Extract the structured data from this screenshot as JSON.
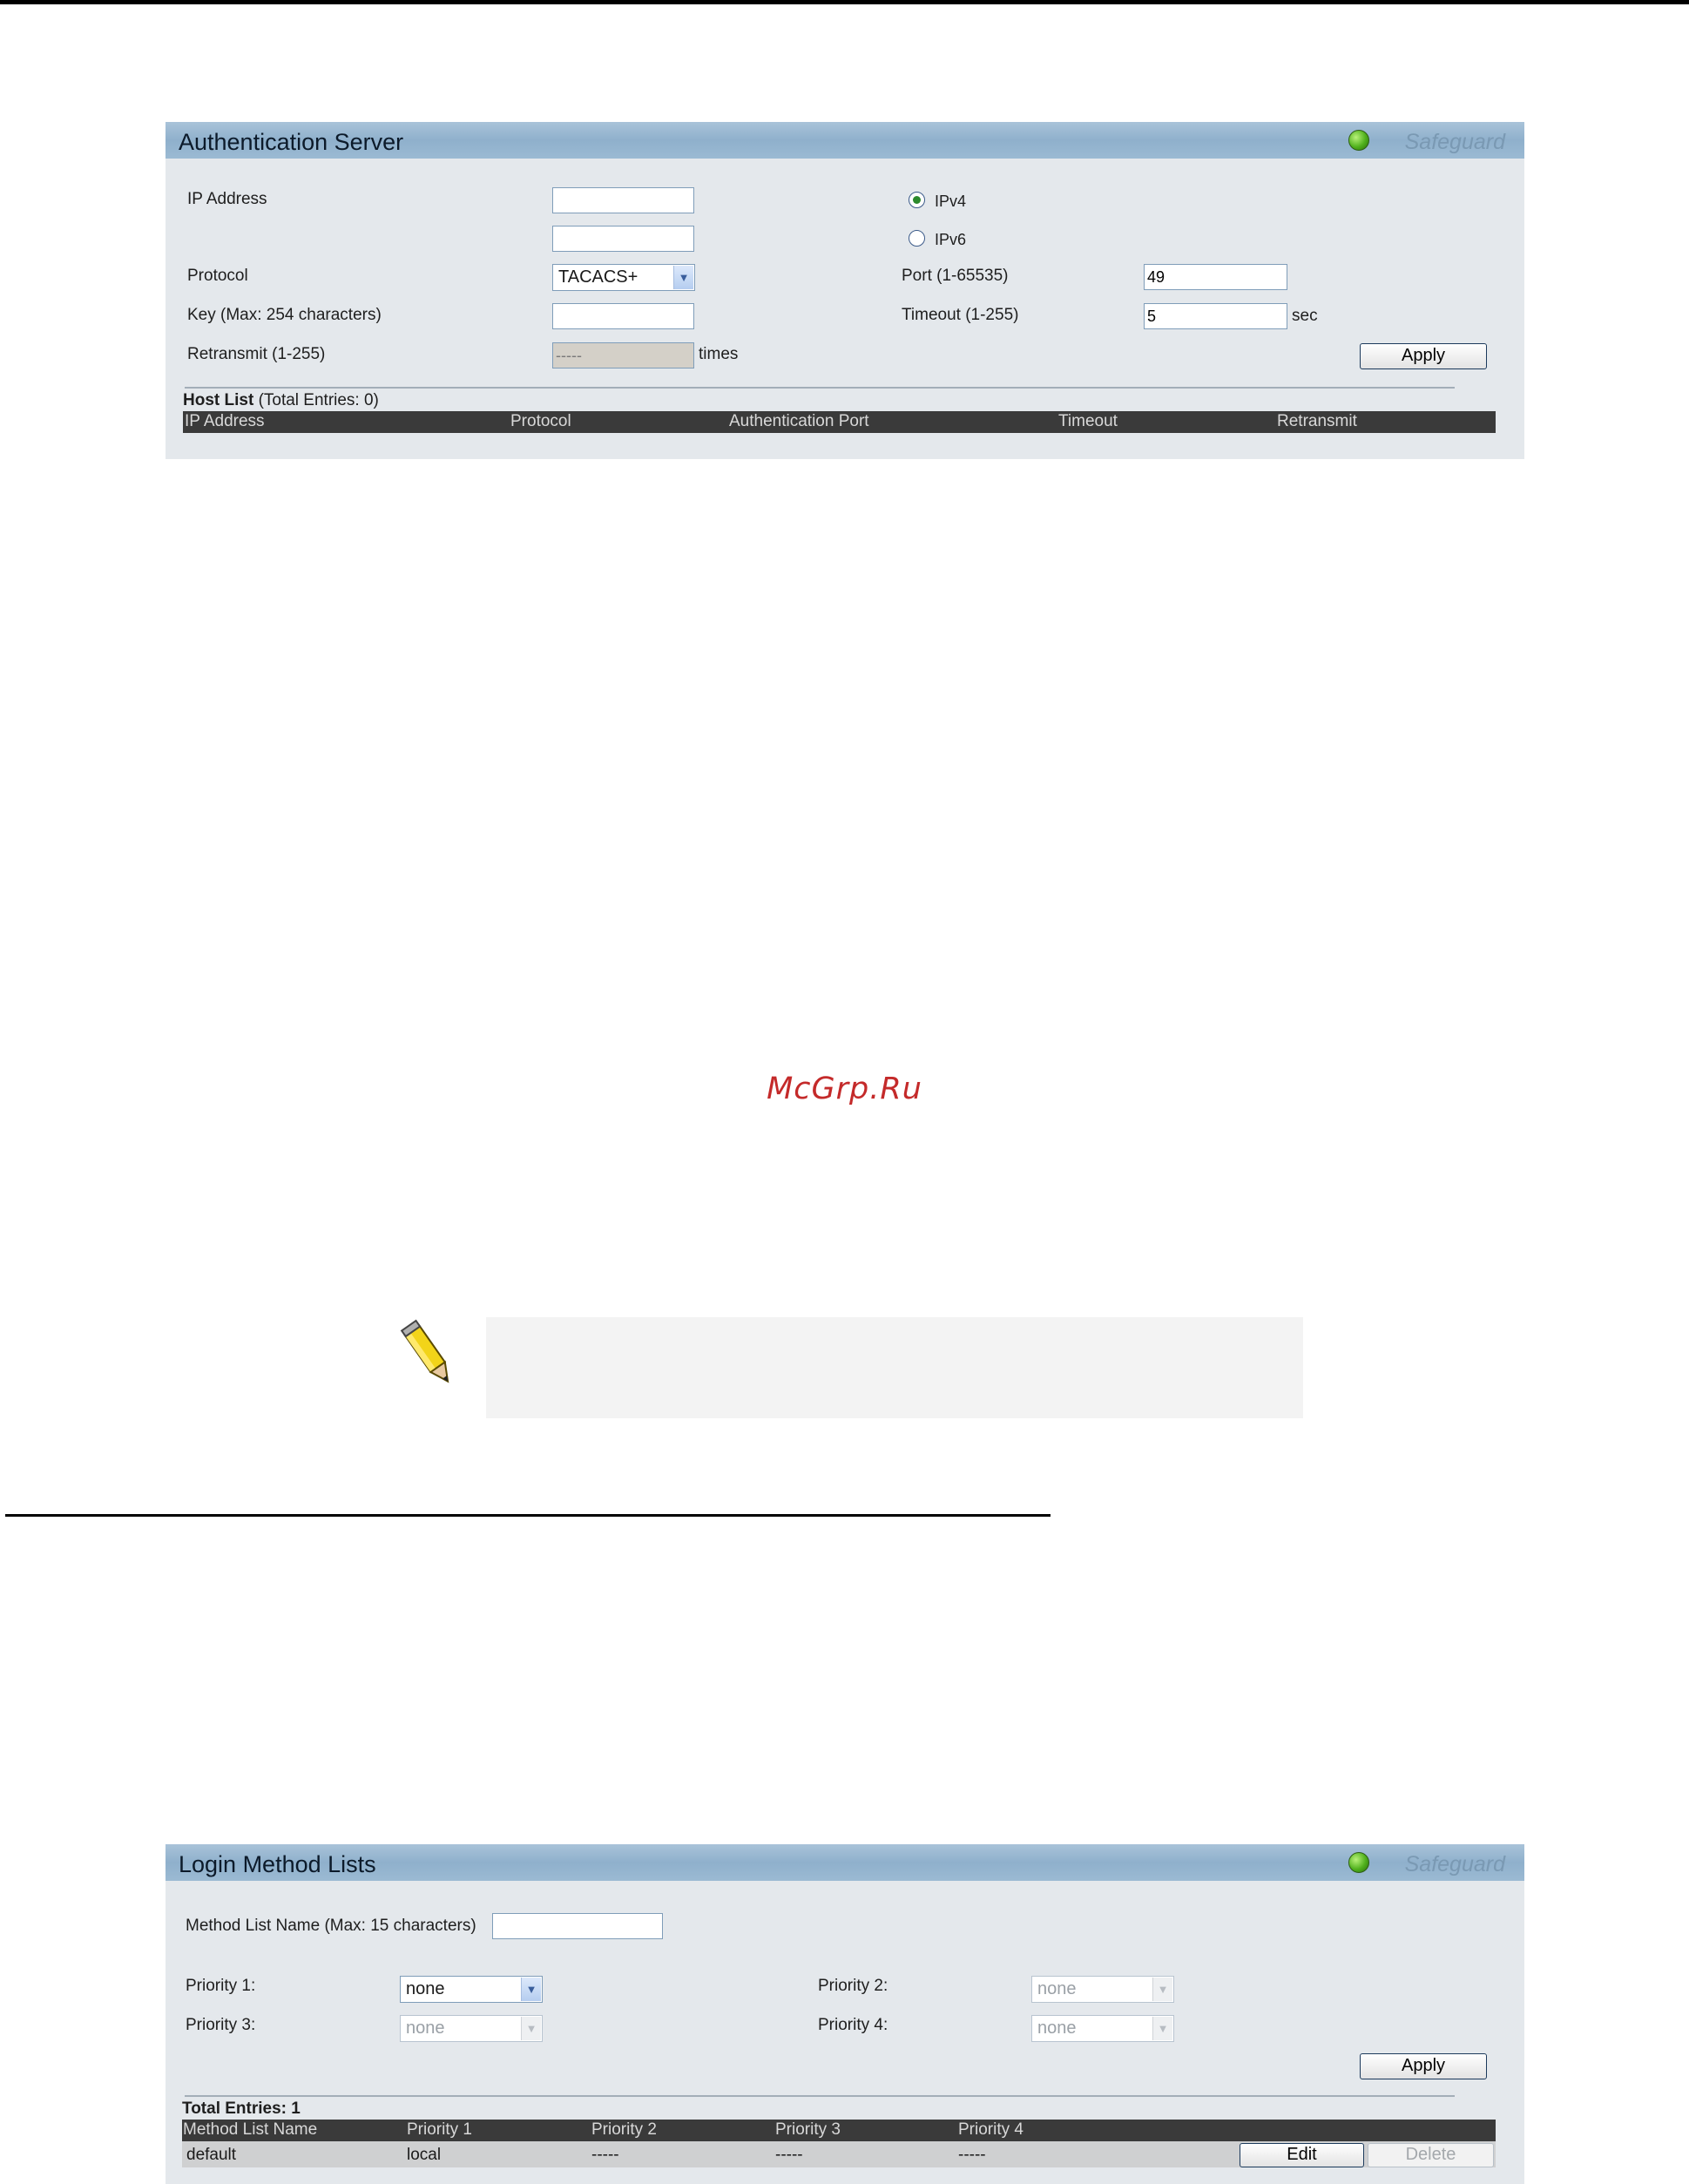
{
  "auth_server": {
    "title": "Authentication Server",
    "safeguard": "Safeguard",
    "ip_address_label": "IP Address",
    "ipv4_label": "IPv4",
    "ipv6_label": "IPv6",
    "ip_version_selected": "IPv4",
    "ipv4_value": "",
    "ipv6_value": "",
    "protocol_label": "Protocol",
    "protocol_value": "TACACS+",
    "port_label": "Port (1-65535)",
    "port_value": "49",
    "key_label": "Key (Max: 254 characters)",
    "key_value": "",
    "timeout_label": "Timeout (1-255)",
    "timeout_value": "5",
    "timeout_unit": "sec",
    "retransmit_label": "Retransmit (1-255)",
    "retransmit_value": "-----",
    "retransmit_unit": "times",
    "apply_label": "Apply",
    "host_list_title": "Host List",
    "host_list_entries": "(Total Entries: 0)",
    "columns": [
      "IP Address",
      "Protocol",
      "Authentication Port",
      "Timeout",
      "Retransmit"
    ]
  },
  "watermark": "McGrp.Ru",
  "note": {
    "icon": "pencil-note-icon",
    "text": ""
  },
  "login_method": {
    "title": "Login Method Lists",
    "safeguard": "Safeguard",
    "name_label": "Method List Name (Max: 15 characters)",
    "name_value": "",
    "priority1_label": "Priority 1:",
    "priority1_value": "none",
    "priority2_label": "Priority 2:",
    "priority2_value": "none",
    "priority3_label": "Priority 3:",
    "priority3_value": "none",
    "priority4_label": "Priority 4:",
    "priority4_value": "none",
    "apply_label": "Apply",
    "total_entries": "Total Entries: 1",
    "columns": [
      "Method List Name",
      "Priority 1",
      "Priority 2",
      "Priority 3",
      "Priority 4"
    ],
    "rows": [
      {
        "name": "default",
        "p1": "local",
        "p2": "-----",
        "p3": "-----",
        "p4": "-----"
      }
    ],
    "edit_label": "Edit",
    "delete_label": "Delete"
  },
  "colors": {
    "panel_header": "#9bbad3",
    "panel_body": "#e4e8ec",
    "table_header": "#3a3a3a",
    "watermark": "#c42a2a",
    "safeguard_led": "#4fb01c"
  }
}
